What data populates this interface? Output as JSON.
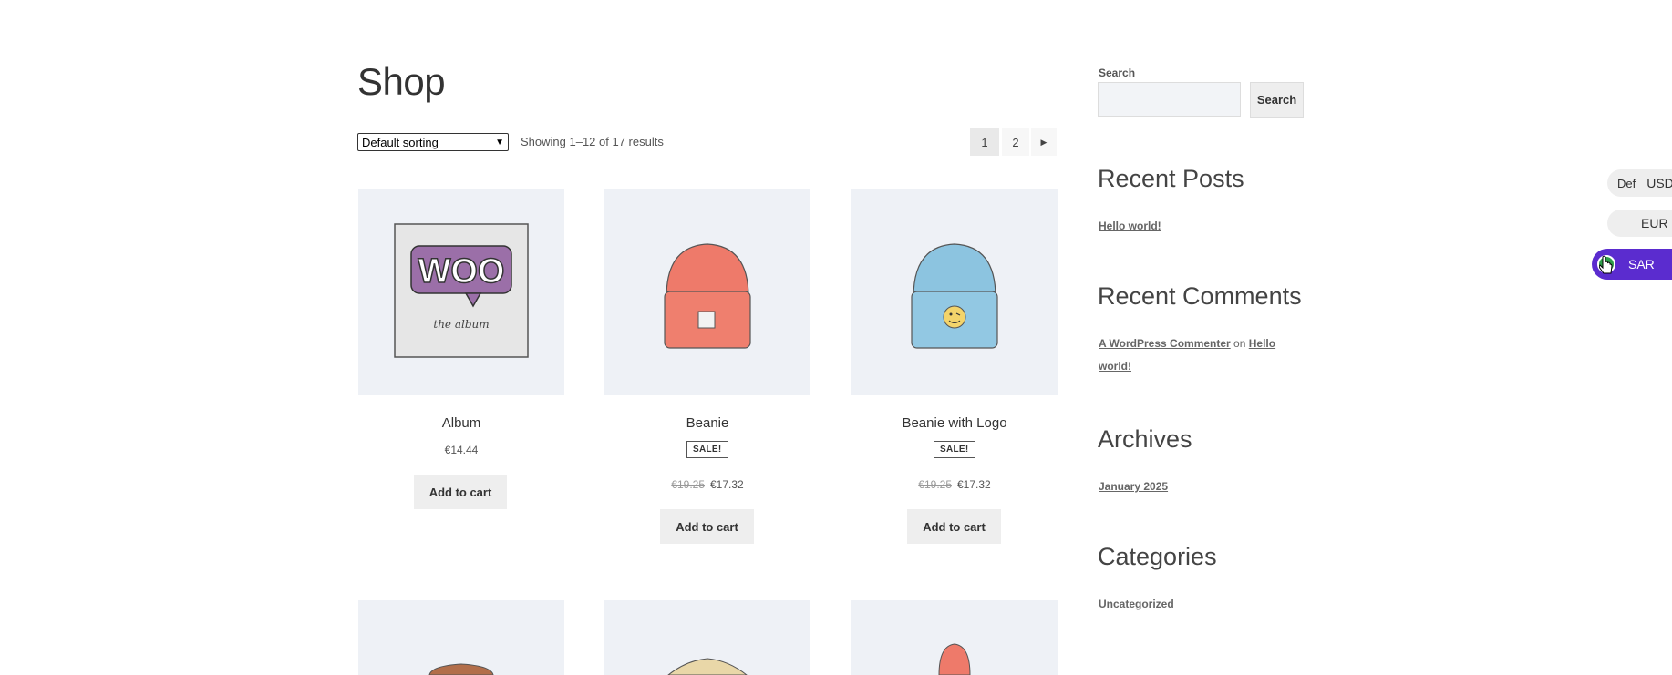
{
  "shop": {
    "title": "Shop",
    "sorting": {
      "selected": "Default sorting"
    },
    "result_count": "Showing 1–12 of 17 results",
    "pagination": {
      "current": "1",
      "pages": [
        "1",
        "2"
      ],
      "next_icon": "triangle-right-icon"
    }
  },
  "products": [
    {
      "name": "Album",
      "price": "€14.44",
      "sale": false,
      "button": "Add to cart"
    },
    {
      "name": "Beanie",
      "regular_price": "€19.25",
      "price": "€17.32",
      "sale": true,
      "badge": "SALE!",
      "button": "Add to cart"
    },
    {
      "name": "Beanie with Logo",
      "regular_price": "€19.25",
      "price": "€17.32",
      "sale": true,
      "badge": "SALE!",
      "button": "Add to cart"
    }
  ],
  "album_art": {
    "logo": "WOO",
    "caption": "the album"
  },
  "sidebar": {
    "search": {
      "label": "Search",
      "button": "Search",
      "value": "",
      "placeholder": ""
    },
    "recent_posts": {
      "title": "Recent Posts",
      "items": [
        "Hello world!"
      ]
    },
    "recent_comments": {
      "title": "Recent Comments",
      "author": "A WordPress Commenter",
      "on": "on",
      "post_line1": "Hello",
      "post_line2": "world!"
    },
    "archives": {
      "title": "Archives",
      "items": [
        "January 2025"
      ]
    },
    "categories": {
      "title": "Categories",
      "items": [
        "Uncategorized"
      ]
    }
  },
  "currency_switcher": {
    "default_label": "Def",
    "options": [
      "USD",
      "EUR",
      "SAR"
    ],
    "active": "SAR",
    "active_color": "#5b2ccf"
  },
  "colors": {
    "product_bg": "#eef1f6",
    "button_bg": "#eeeeee",
    "beanie": "#ee7a6a",
    "beanie_logo": "#8cc4e0",
    "woo_purple": "#9b6fa8"
  }
}
